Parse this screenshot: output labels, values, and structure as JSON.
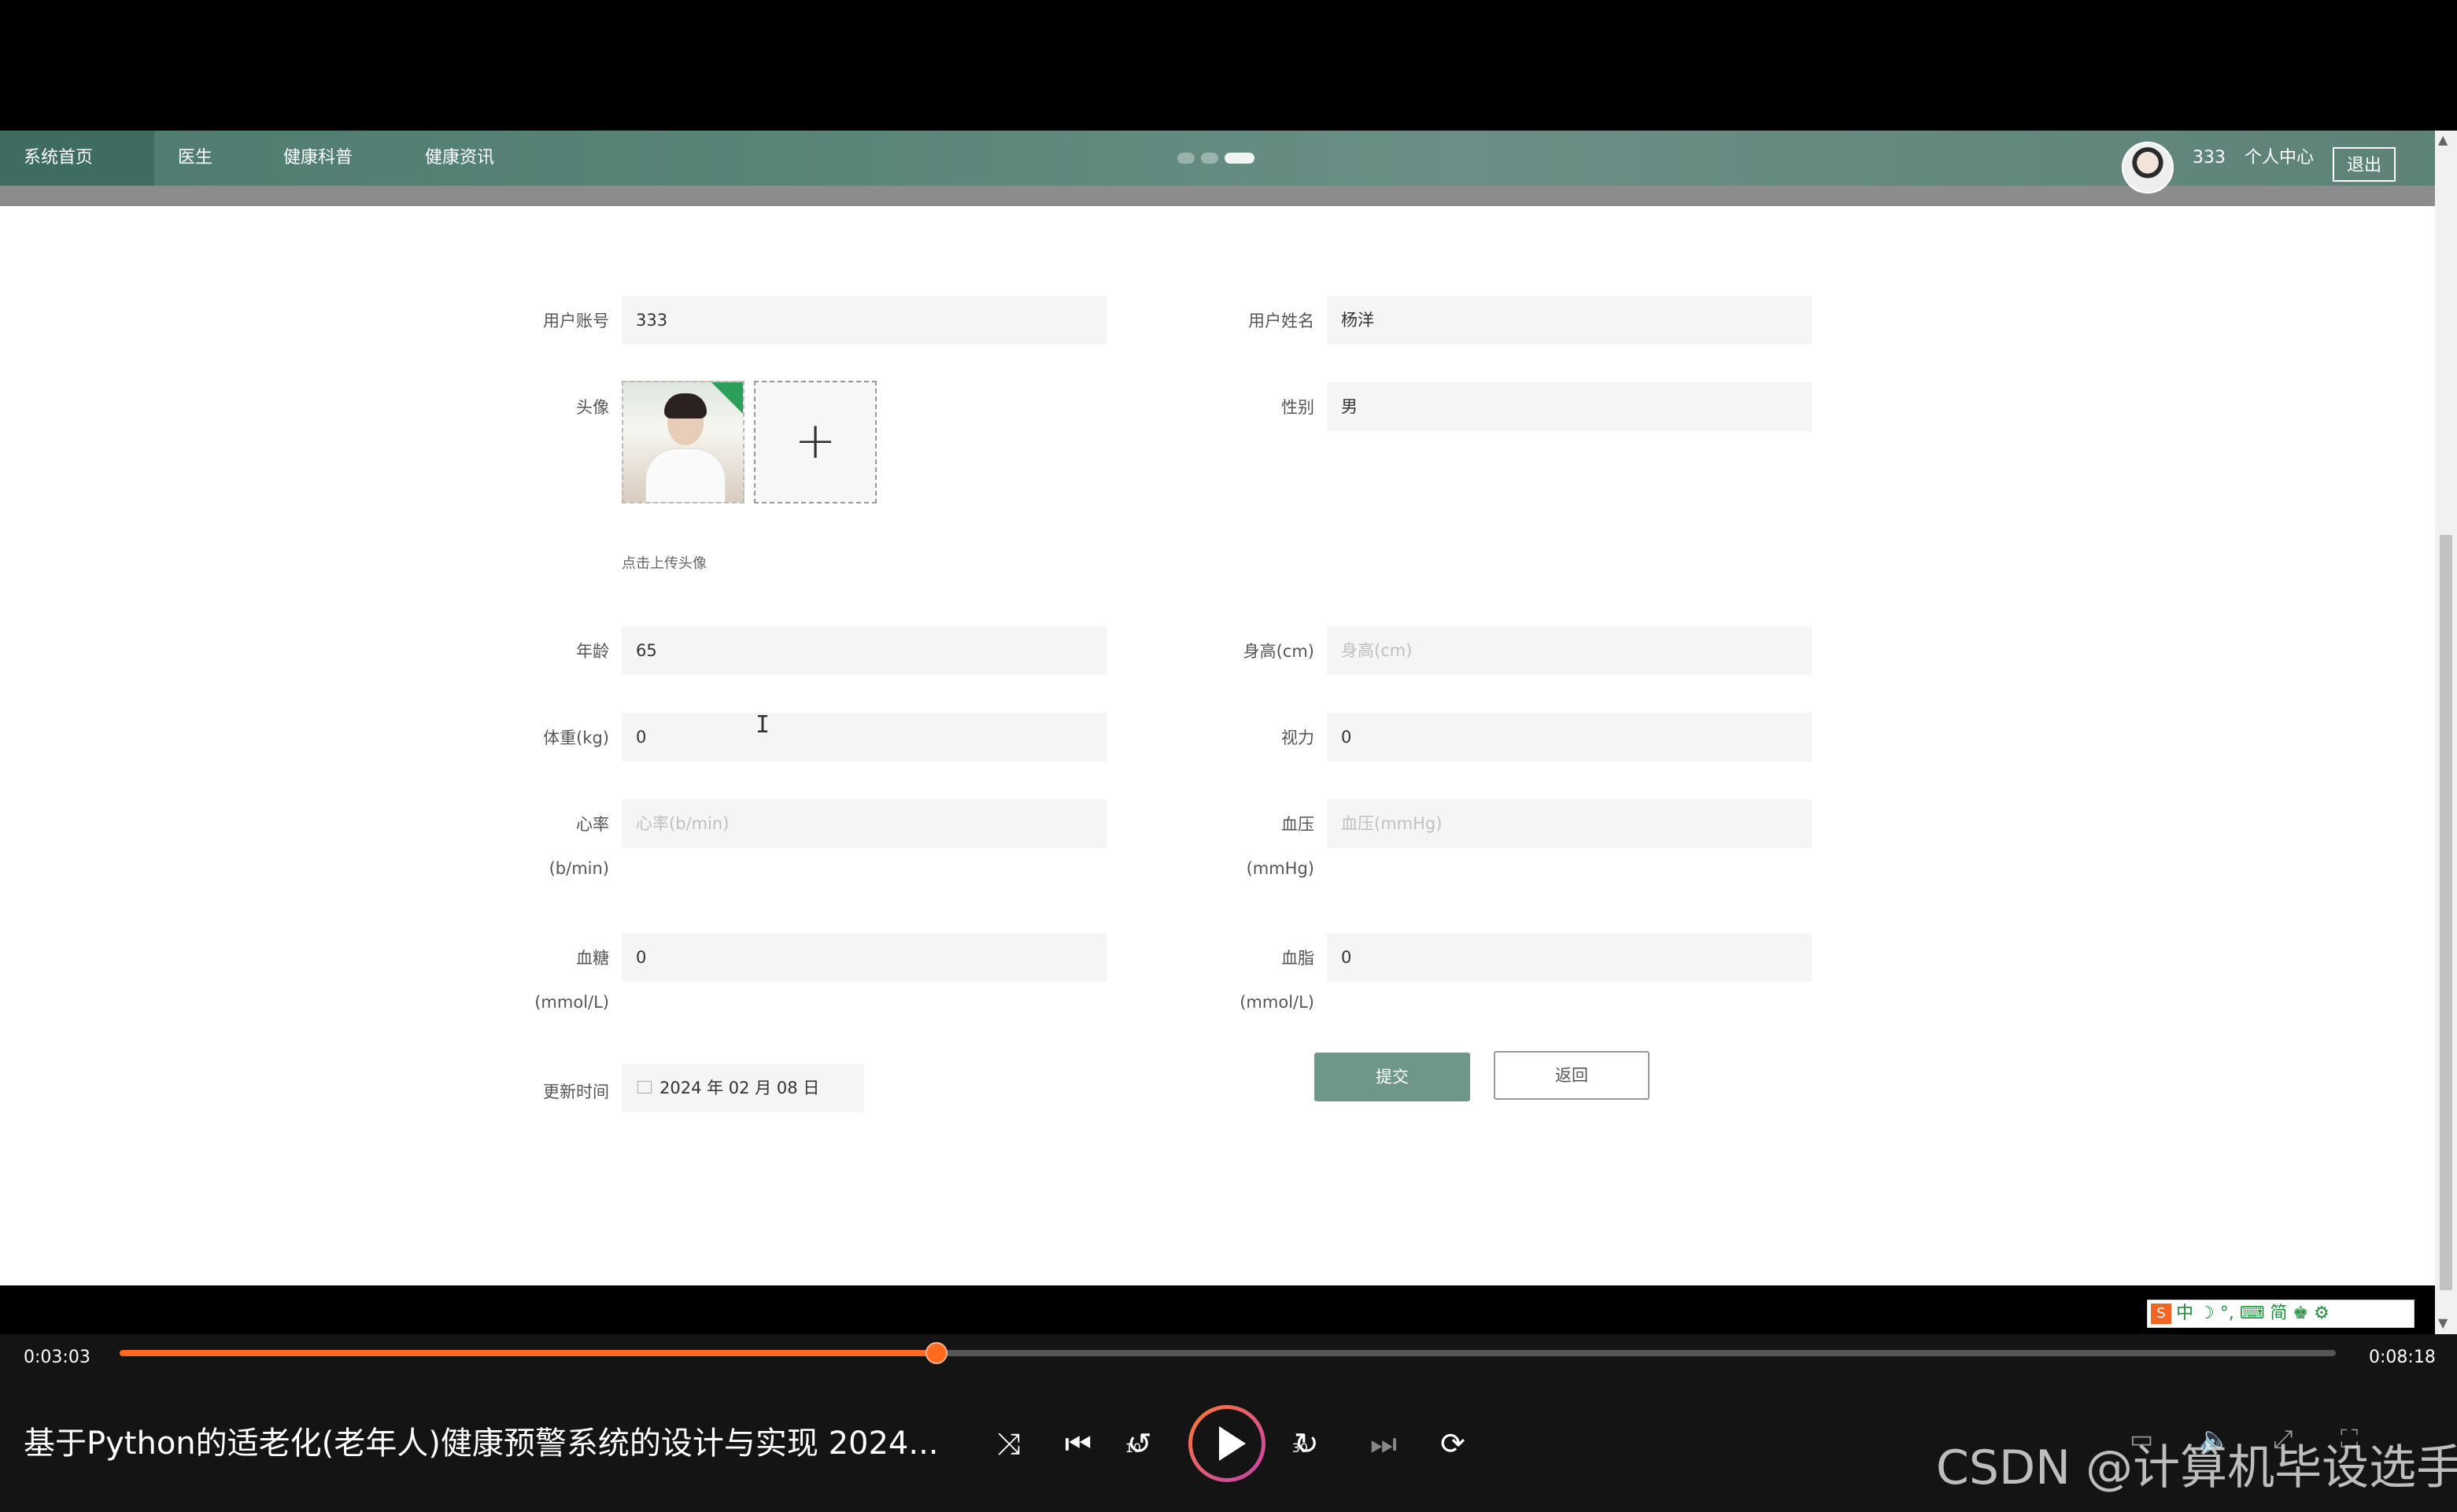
{
  "nav": {
    "items": [
      "系统首页",
      "医生",
      "健康科普",
      "健康资讯"
    ],
    "user": "333",
    "personal_center": "个人中心",
    "logout": "退出"
  },
  "form": {
    "account_label": "用户账号",
    "account_value": "333",
    "name_label": "用户姓名",
    "name_value": "杨洋",
    "avatar_label": "头像",
    "upload_plus": "+",
    "upload_hint": "点击上传头像",
    "gender_label": "性别",
    "gender_value": "男",
    "age_label": "年龄",
    "age_value": "65",
    "height_label": "身高(cm)",
    "height_placeholder": "身高(cm)",
    "weight_label": "体重(kg)",
    "weight_value": "0",
    "vision_label": "视力",
    "vision_value": "0",
    "heart_label": "心率",
    "heart_unit": "(b/min)",
    "heart_placeholder": "心率(b/min)",
    "bp_label": "血压",
    "bp_unit": "(mmHg)",
    "bp_placeholder": "血压(mmHg)",
    "sugar_label": "血糖",
    "sugar_unit": "(mmol/L)",
    "sugar_value": "0",
    "lipid_label": "血脂",
    "lipid_unit": "(mmol/L)",
    "lipid_value": "0",
    "update_label": "更新时间",
    "update_value": "2024 年 02 月 08 日",
    "submit": "提交",
    "back": "返回"
  },
  "ime": {
    "text": "中 ☽ °, ⌨ 简 ♚ ⚙",
    "logo": "S"
  },
  "player": {
    "current_time": "0:03:03",
    "total_time": "0:08:18",
    "progress": 0.3685,
    "title": "基于Python的适老化(老年人)健康预警系统的设计与实现 2024...",
    "watermark": "CSDN @计算机毕设选手",
    "icons": {
      "shuffle": "⤨",
      "prev": "⏮",
      "rewind": "↺",
      "forward": "↻",
      "next": "⏭",
      "repeat": "⟳"
    },
    "rewind_label": "10",
    "forward_label": "30"
  }
}
